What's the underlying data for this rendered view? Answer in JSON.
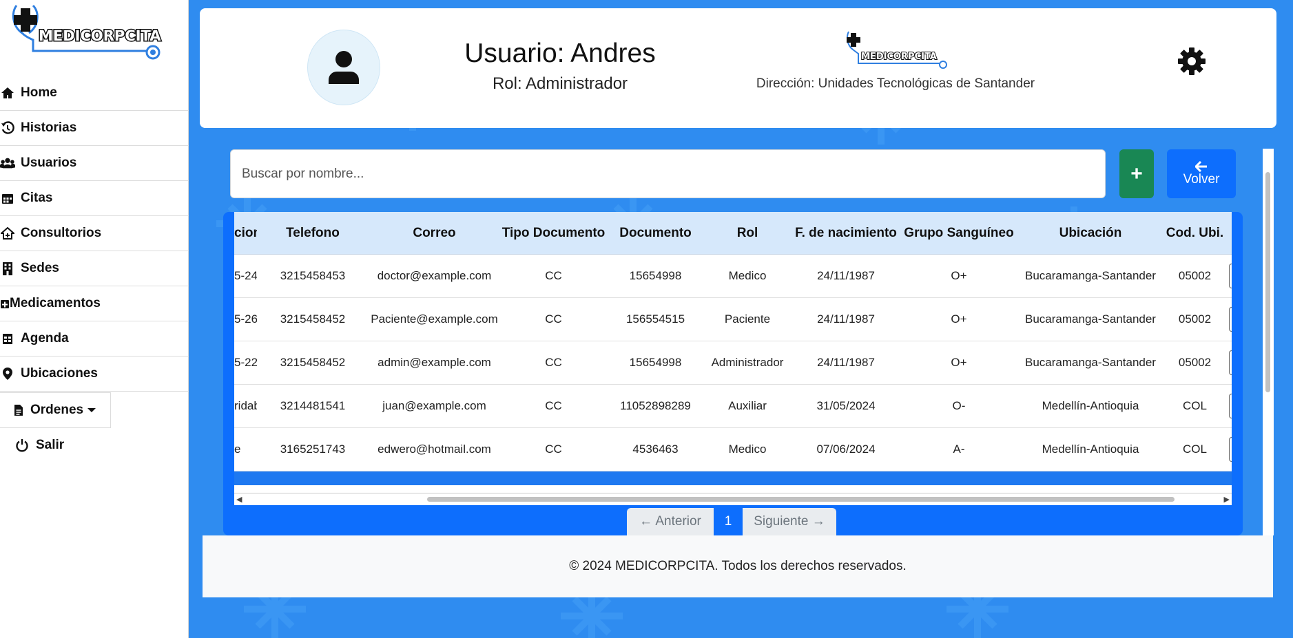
{
  "app": {
    "brand": "MEDICORPCITA"
  },
  "sidebar": {
    "items": [
      {
        "label": "Home",
        "icon": "home-icon"
      },
      {
        "label": "Historias",
        "icon": "history-icon"
      },
      {
        "label": " Usuarios",
        "icon": "users-icon"
      },
      {
        "label": "Citas",
        "icon": "calendar-icon"
      },
      {
        "label": "Consultorios",
        "icon": "clinic-icon"
      },
      {
        "label": "Sedes",
        "icon": "building-icon"
      },
      {
        "label": "Medicamentos",
        "icon": "medkit-icon"
      },
      {
        "label": "Agenda",
        "icon": "agenda-icon"
      },
      {
        "label": "Ubicaciones",
        "icon": "location-pin-icon"
      }
    ],
    "dropdown": {
      "label": "Ordenes",
      "icon": "document-icon"
    },
    "logout": {
      "label": "Salir",
      "icon": "power-icon"
    }
  },
  "header": {
    "user_label": "Usuario: Andres",
    "role_label": "Rol: Administrador",
    "address": "Dirección: Unidades Tecnológicas de Santander"
  },
  "search": {
    "placeholder": "Buscar por nombre..."
  },
  "buttons": {
    "add": "+",
    "back": "Volver"
  },
  "table": {
    "columns": [
      "cion",
      "Telefono",
      "Correo",
      "Tipo Documento",
      "Documento",
      "Rol",
      "F. de nacimiento",
      "Grupo Sanguíneo",
      "Ubicación",
      "Cod. Ubi."
    ],
    "rows": [
      [
        "5-24",
        "3215458453",
        "doctor@example.com",
        "CC",
        "15654998",
        "Medico",
        "24/11/1987",
        "O+",
        "Bucaramanga-Santander",
        "05002"
      ],
      [
        "5-26",
        "3215458452",
        "Paciente@example.com",
        "CC",
        "156554515",
        "Paciente",
        "24/11/1987",
        "O+",
        "Bucaramanga-Santander",
        "05002"
      ],
      [
        "5-22",
        "3215458452",
        "admin@example.com",
        "CC",
        "15654998",
        "Administrador",
        "24/11/1987",
        "O+",
        "Bucaramanga-Santander",
        "05002"
      ],
      [
        "ridablanca",
        "3214481541",
        "juan@example.com",
        "CC",
        "11052898289",
        "Auxiliar",
        "31/05/2024",
        "O-",
        "Medellín-Antioquia",
        "COL"
      ],
      [
        "e",
        "3165251743",
        "edwero@hotmail.com",
        "CC",
        "4536463",
        "Medico",
        "07/06/2024",
        "A-",
        "Medellín-Antioquia",
        "COL"
      ]
    ]
  },
  "pagination": {
    "prev": "← Anterior",
    "page": "1",
    "next": "Siguiente →"
  },
  "footer": {
    "text": "© 2024 MEDICORPCITA. Todos los derechos reservados."
  },
  "colors": {
    "background": "#2f8cf0",
    "primary": "#0d6efd",
    "success": "#198754",
    "table_header": "#d6e8fb"
  }
}
